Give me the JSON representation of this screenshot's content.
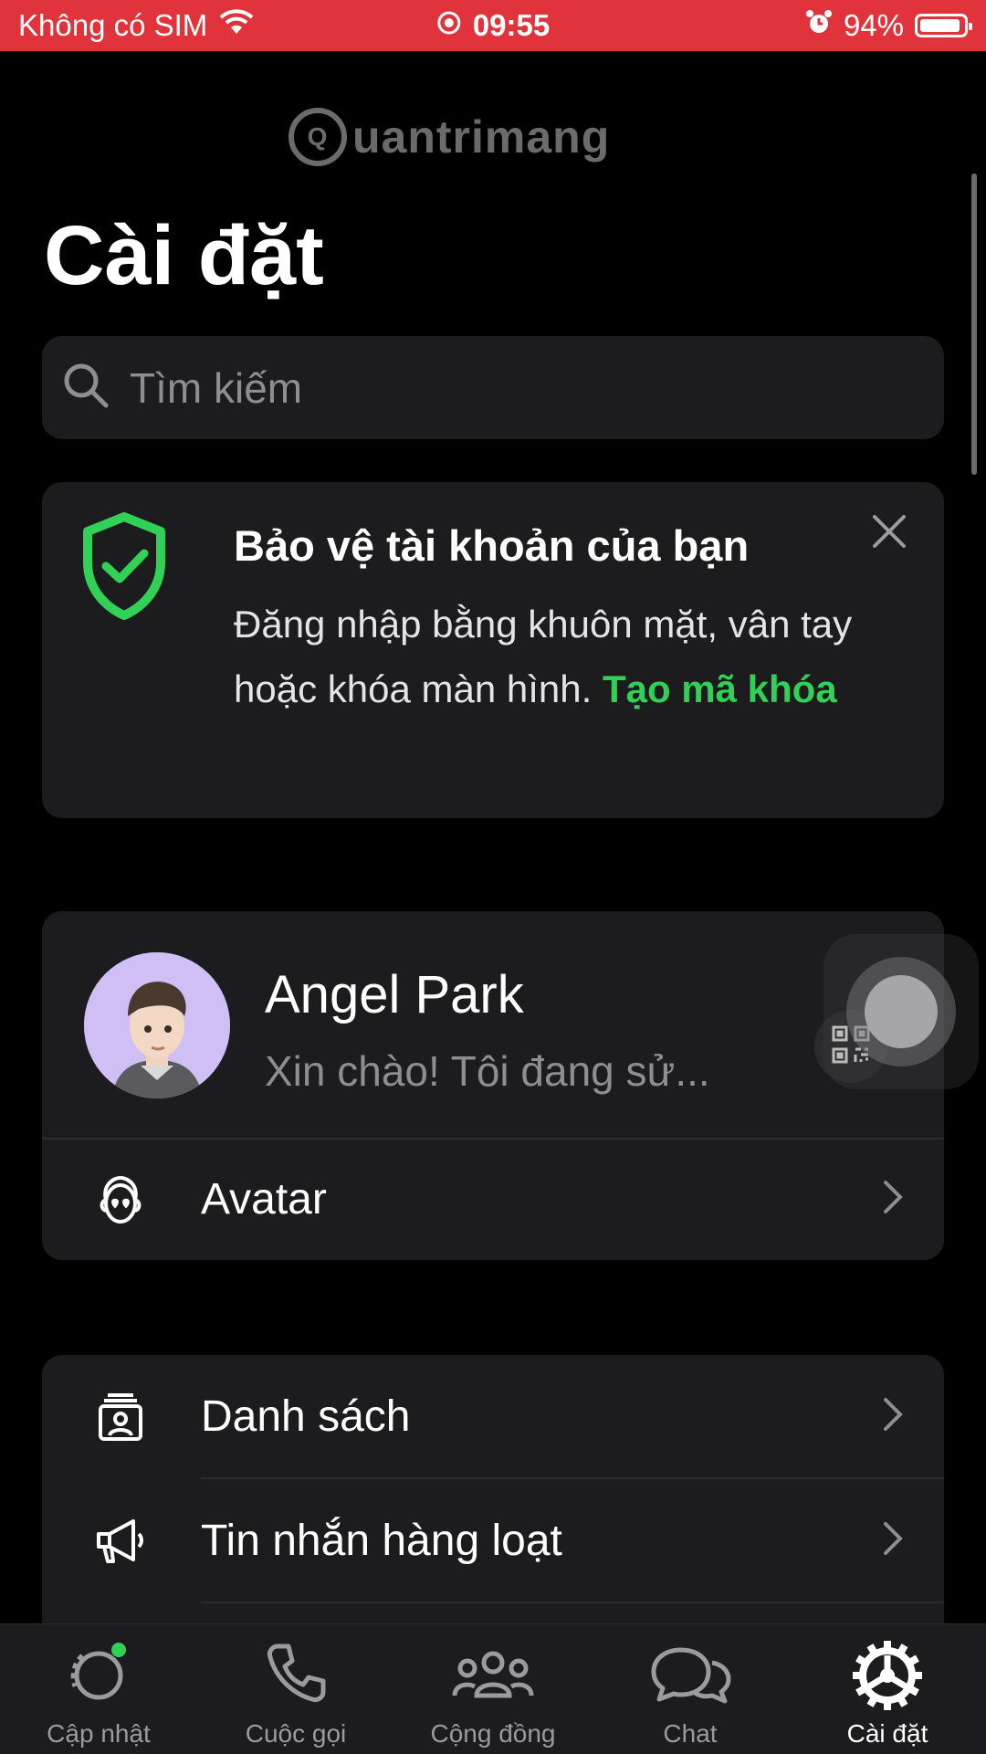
{
  "status_bar": {
    "carrier": "Không có SIM",
    "time": "09:55",
    "battery": "94%",
    "battery_level": 0.94
  },
  "watermark": {
    "text": "uantrimang",
    "logo_letter": "Q"
  },
  "page_title": "Cài đặt",
  "search": {
    "placeholder": "Tìm kiếm"
  },
  "protect_card": {
    "title": "Bảo vệ tài khoản của bạn",
    "body": "Đăng nhập bằng khuôn mặt, vân tay hoặc khóa màn hình.",
    "link": "Tạo mã khóa",
    "accent": "#31d158"
  },
  "profile": {
    "name": "Angel Park",
    "status": "Xin chào! Tôi đang sử...",
    "avatar_row_label": "Avatar"
  },
  "list": {
    "items": [
      {
        "label": "Danh sách",
        "icon": "contacts-list-icon"
      },
      {
        "label": "Tin nhắn hàng loạt",
        "icon": "megaphone-icon"
      }
    ]
  },
  "tabs": [
    {
      "label": "Cập nhật",
      "icon": "updates-icon",
      "active": false
    },
    {
      "label": "Cuộc gọi",
      "icon": "phone-icon",
      "active": false
    },
    {
      "label": "Cộng đồng",
      "icon": "community-icon",
      "active": false
    },
    {
      "label": "Chat",
      "icon": "chat-icon",
      "active": false
    },
    {
      "label": "Cài đặt",
      "icon": "settings-icon",
      "active": true
    }
  ]
}
